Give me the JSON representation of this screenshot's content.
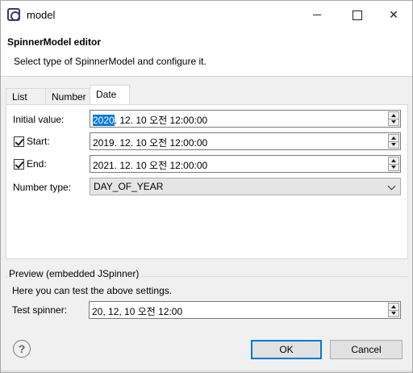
{
  "window": {
    "title": "model",
    "icon": "eclipse-app-icon",
    "controls": [
      "minimize-icon",
      "maximize-icon",
      "close-icon"
    ]
  },
  "header": {
    "title": "SpinnerModel editor",
    "description": "Select type of SpinnerModel and configure it."
  },
  "tabs": [
    {
      "label": "List",
      "selected": false
    },
    {
      "label": "Number",
      "selected": false
    },
    {
      "label": "Date",
      "selected": true
    }
  ],
  "date_tab": {
    "initial_label": "Initial value:",
    "initial_year": "2020",
    "initial_rest": ". 12. 10 오전 12:00:00",
    "start_label": "Start:",
    "start_checked": true,
    "start_value": "2019. 12. 10 오전 12:00:00",
    "end_label": "End:",
    "end_checked": true,
    "end_value": "2021. 12. 10 오전 12:00:00",
    "number_type_label": "Number type:",
    "number_type_value": "DAY_OF_YEAR"
  },
  "preview": {
    "title": "Preview (embedded JSpinner)",
    "description": "Here you can test the above settings.",
    "test_label": "Test spinner:",
    "test_value": "20, 12, 10 오전 12:00"
  },
  "buttons": {
    "ok": "OK",
    "cancel": "Cancel",
    "help_glyph": "?"
  },
  "colors": {
    "selection": "#0078d7",
    "window_bg": "#f0f0f0"
  }
}
